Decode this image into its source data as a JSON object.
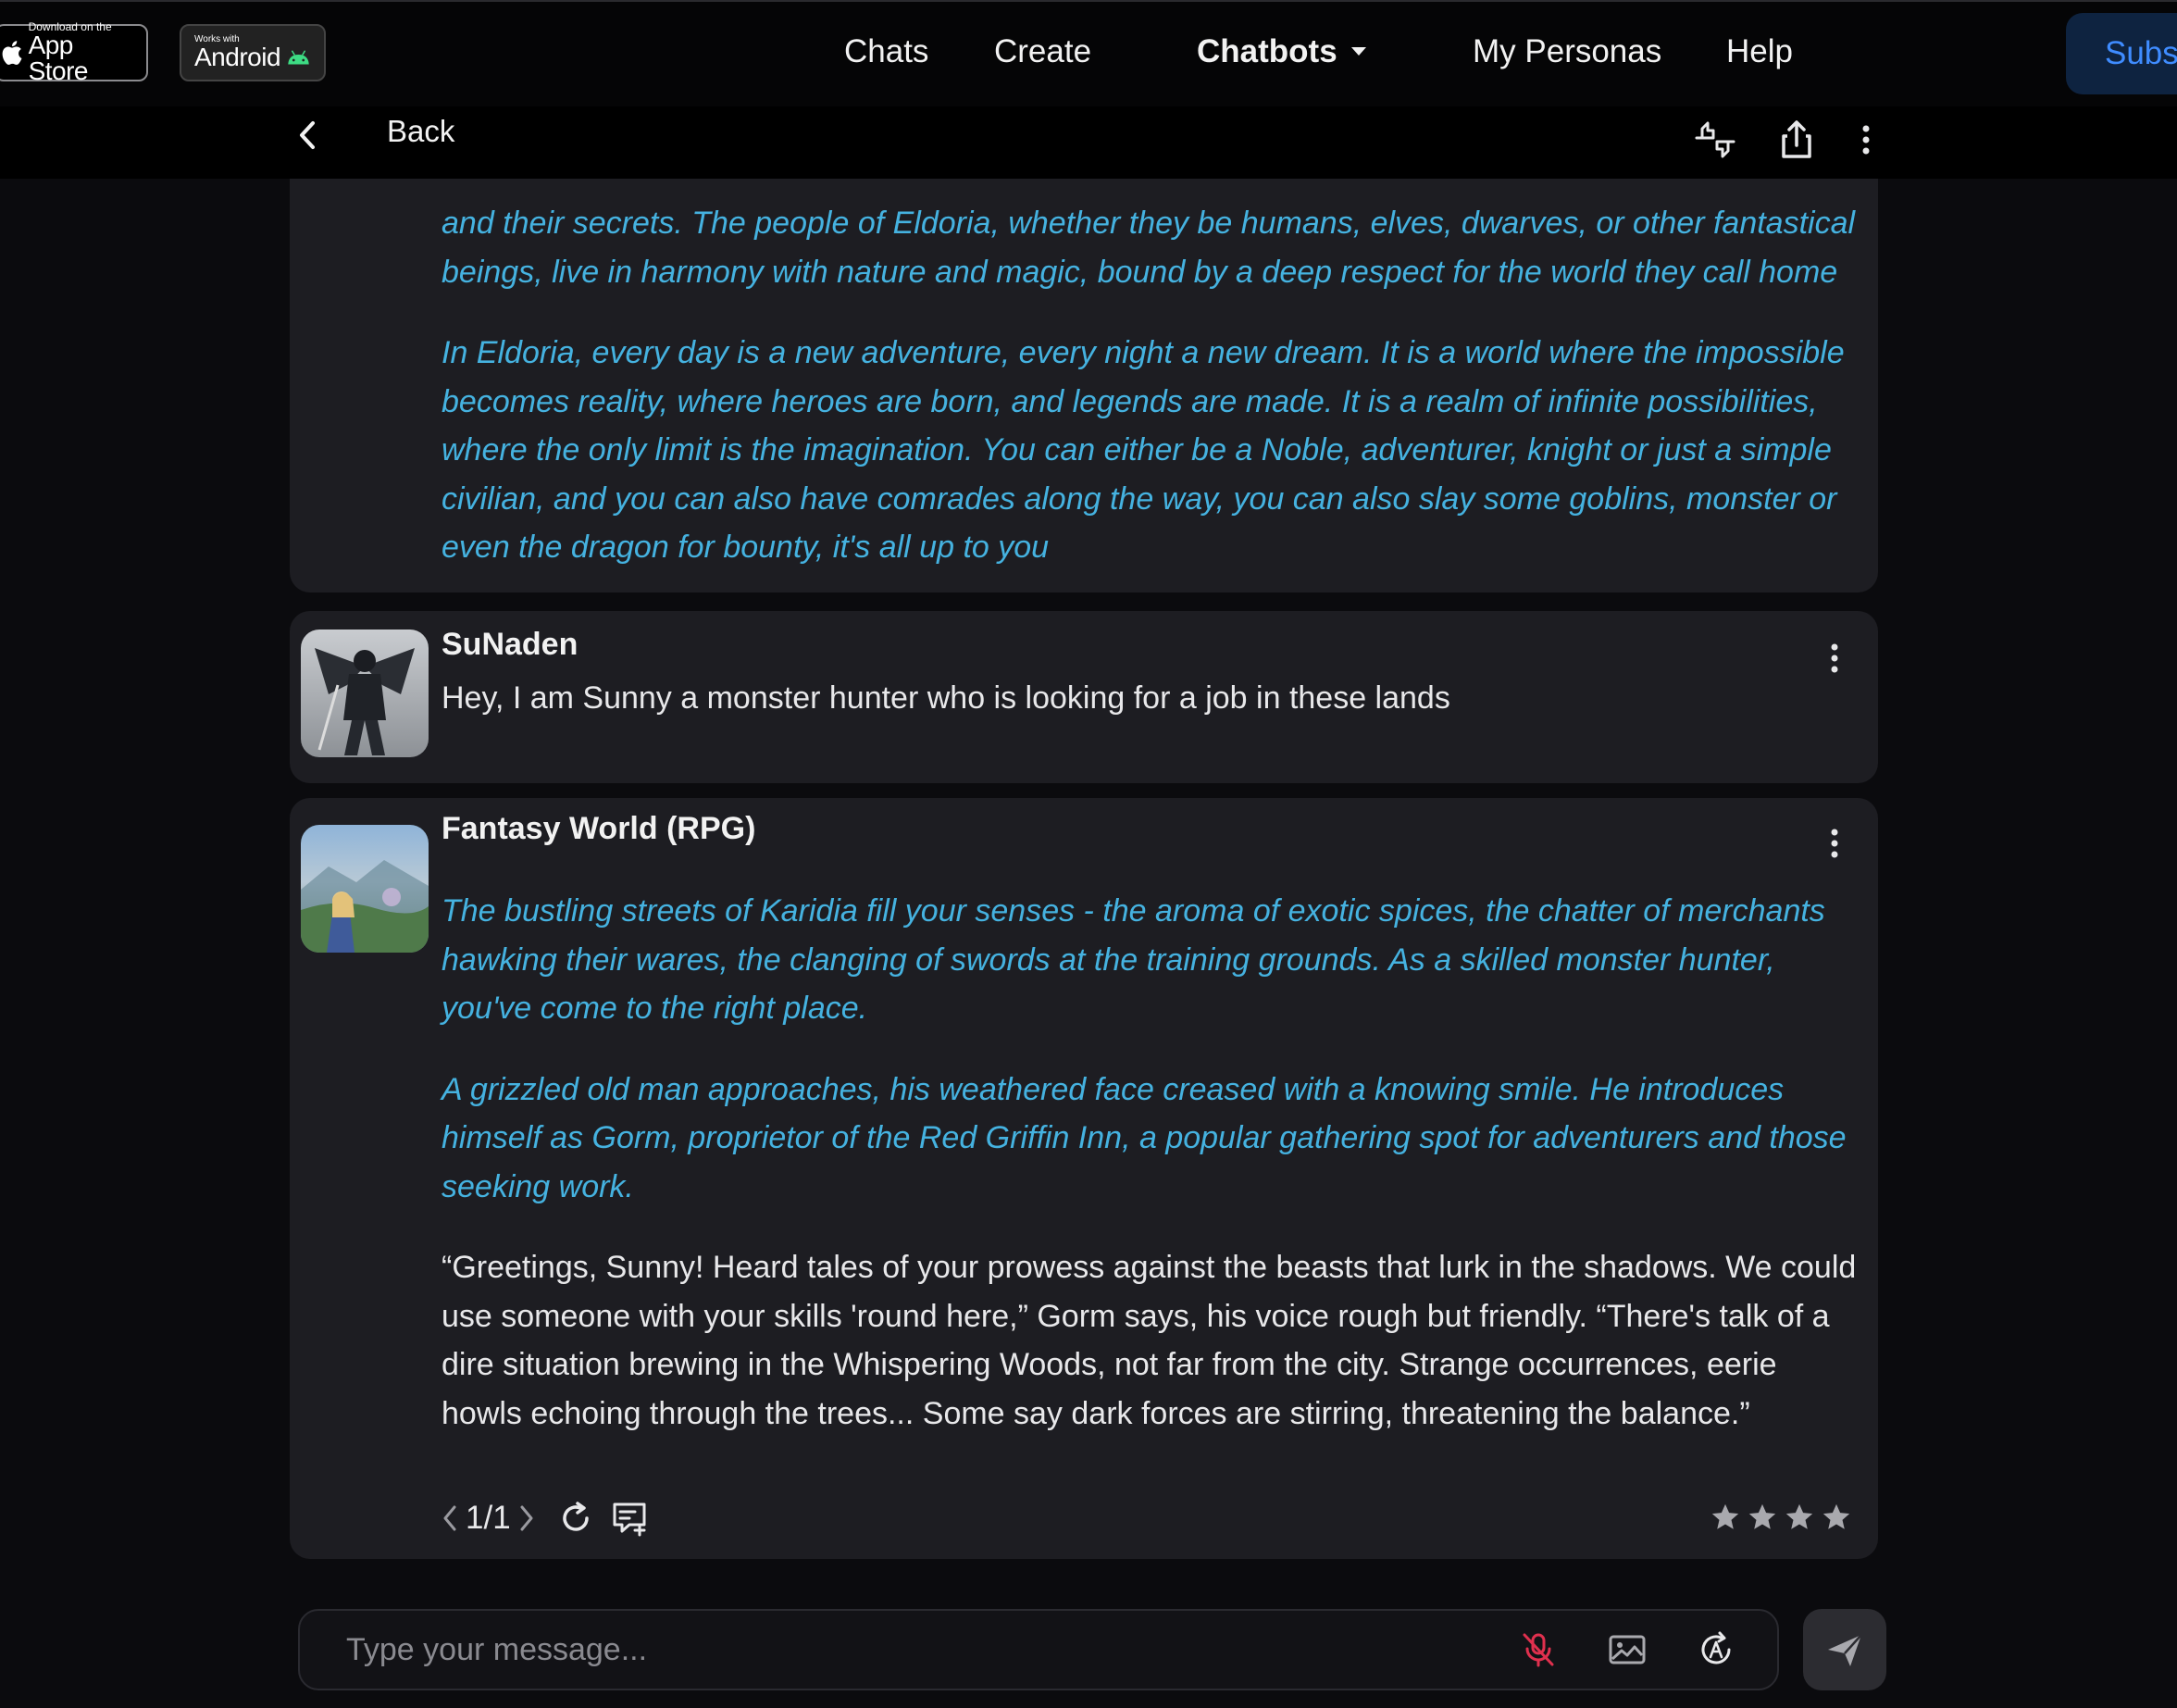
{
  "badges": {
    "appstore_small": "Download on the",
    "appstore_big": "App Store",
    "android_small": "Works with",
    "android_big": "Android"
  },
  "nav": {
    "chats": "Chats",
    "create": "Create",
    "chatbots": "Chatbots",
    "personas": "My Personas",
    "help": "Help",
    "subscribe": "Subs"
  },
  "subbar": {
    "back": "Back",
    "icons": [
      "thumbs-icon",
      "share-icon",
      "more-vertical-icon"
    ]
  },
  "messages": {
    "first": {
      "p1": "and their secrets. The people of Eldoria, whether they be humans, elves, dwarves, or other fantastical beings, live in harmony with nature and magic, bound by a deep respect for the world they call home",
      "p2": "In Eldoria, every day is a new adventure, every night a new dream. It is a world where the impossible becomes reality, where heroes are born, and legends are made. It is a realm of infinite possibilities, where the only limit is the imagination. You can either be a Noble, adventurer, knight or just a simple civilian, and you can also have comrades along the way, you can also slay some goblins, monster or even the dragon for bounty, it's all up to you"
    },
    "user": {
      "name": "SuNaden",
      "text": "Hey, I am Sunny a monster hunter who is looking for a job in these lands"
    },
    "bot": {
      "name": "Fantasy World (RPG)",
      "p1": "The bustling streets of Karidia fill your senses - the aroma of exotic spices, the chatter of merchants hawking their wares, the clanging of swords at the training grounds. As a skilled monster hunter, you've come to the right place.",
      "p2": "A grizzled old man approaches, his weathered face creased with a knowing smile. He introduces himself as Gorm, proprietor of the Red Griffin Inn, a popular gathering spot for adventurers and those seeking work.",
      "p3": "“Greetings, Sunny! Heard tales of your prowess against the beasts that lurk in the shadows. We could use someone with your skills 'round here,” Gorm says, his voice rough but friendly. “There's talk of a dire situation brewing in the Whispering Woods, not far from the city. Strange occurrences, eerie howls echoing through the trees... Some say dark forces are stirring, threatening the balance.”",
      "counter": "1/1",
      "rating": 4
    }
  },
  "composer": {
    "placeholder": "Type your message..."
  },
  "colors": {
    "accent": "#3f8cff",
    "action_text": "#45b2e0",
    "mic_muted": "#e0304e",
    "bubble_bg": "#1d1d22"
  }
}
